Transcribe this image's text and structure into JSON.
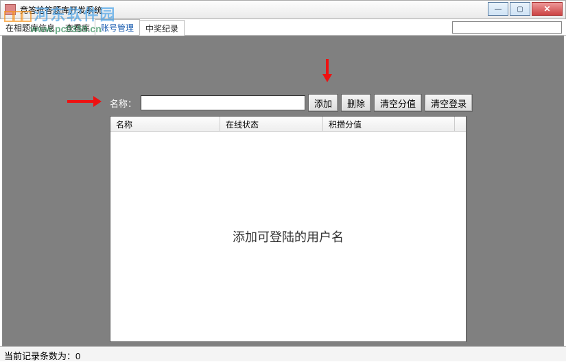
{
  "window": {
    "title": "竞答抢答题库开发系统"
  },
  "tabs": {
    "t1": "在相题库信息",
    "t2": "查看库",
    "t3": "账号管理",
    "t4": "中奖纪录"
  },
  "controls": {
    "name_label": "名称：",
    "name_value": "",
    "add": "添加",
    "delete": "删除",
    "clear_score": "清空分值",
    "clear_login": "清空登录"
  },
  "table": {
    "col_name": "名称",
    "col_online": "在线状态",
    "col_score": "积攒分值",
    "empty_msg": "添加可登陆的用户名"
  },
  "status": {
    "text": "当前记录条数为：0"
  },
  "watermark": {
    "cn": "河东软件园",
    "url": "www.pc0359.cn"
  }
}
